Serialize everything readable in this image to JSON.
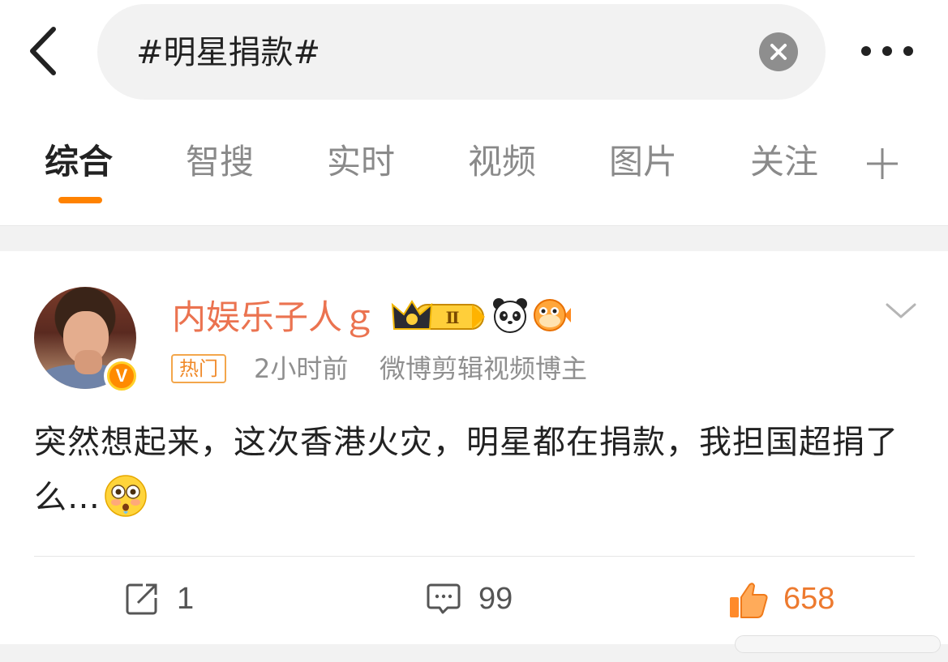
{
  "header": {
    "search_query": "#明星捐款#",
    "icons": {
      "back": "chevron-left-icon",
      "clear": "clear-circle-icon",
      "more": "more-dots-icon"
    }
  },
  "tabs": {
    "items": [
      {
        "label": "综合",
        "active": true
      },
      {
        "label": "智搜",
        "active": false
      },
      {
        "label": "实时",
        "active": false
      },
      {
        "label": "视频",
        "active": false
      },
      {
        "label": "图片",
        "active": false
      },
      {
        "label": "关注",
        "active": false
      }
    ],
    "add_icon": "plus-icon",
    "accent_color": "#ff8200"
  },
  "post": {
    "author": {
      "name": "内娱乐子人ｇ",
      "verified_badge": "V",
      "badges": [
        "crown-level-badge",
        "panda-icon",
        "pufferfish-icon"
      ],
      "crown_level": "Ⅱ"
    },
    "tag": "热门",
    "time": "2小时前",
    "author_desc": "微博剪辑视频博主",
    "text": "突然想起来，这次香港火灾，明星都在捐款，我担国超捐了么…",
    "emoji": "flushed-face-emoji",
    "actions": {
      "share_count": "1",
      "comment_count": "99",
      "like_count": "658"
    },
    "name_color": "#eb7350",
    "like_color": "#ed7a2f"
  }
}
